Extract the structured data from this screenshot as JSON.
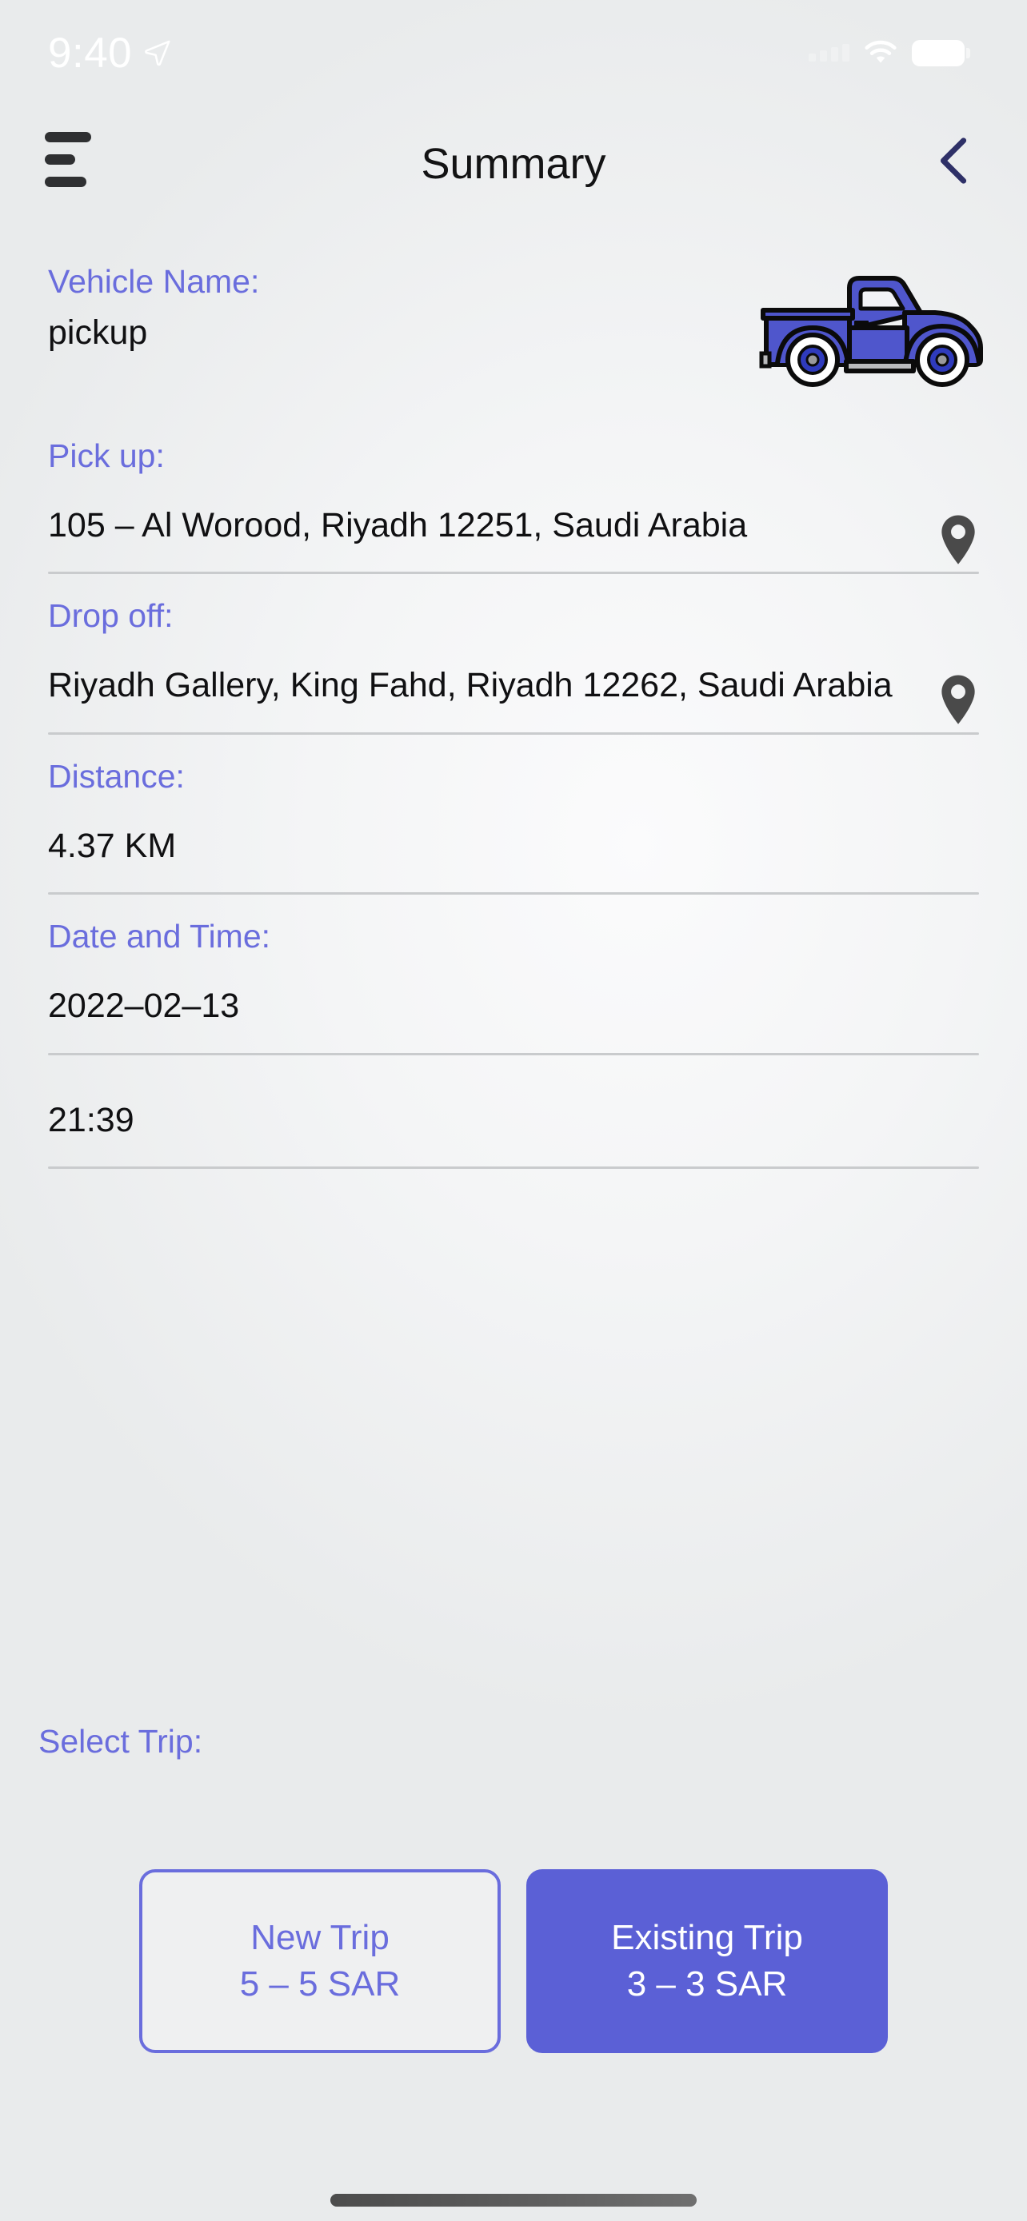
{
  "status_bar": {
    "time": "9:40",
    "location_icon": "location-arrow-icon",
    "signal_icon": "cellular-signal-icon",
    "wifi_icon": "wifi-icon",
    "battery_icon": "battery-icon"
  },
  "header": {
    "menu_icon": "hamburger-menu-icon",
    "title": "Summary",
    "back_icon": "chevron-left-icon"
  },
  "vehicle": {
    "label": "Vehicle Name:",
    "value": "pickup",
    "image_icon": "pickup-truck-illustration",
    "image_color": "#4f56cc"
  },
  "pickup": {
    "label": "Pick up:",
    "value": "105 – Al Worood, Riyadh 12251, Saudi Arabia",
    "pin_icon": "map-pin-icon"
  },
  "dropoff": {
    "label": "Drop off:",
    "value": "Riyadh Gallery, King Fahd, Riyadh 12262, Saudi Arabia",
    "pin_icon": "map-pin-icon"
  },
  "distance": {
    "label": "Distance:",
    "value": "4.37 KM"
  },
  "date_time": {
    "label": "Date and Time:",
    "date_value": "2022–02–13",
    "time_value": "21:39"
  },
  "select_trip": {
    "label": "Select Trip:",
    "options": [
      {
        "title": "New Trip",
        "price": "5 – 5 SAR",
        "selected": false
      },
      {
        "title": "Existing Trip",
        "price": "3 – 3 SAR",
        "selected": true
      }
    ]
  },
  "colors": {
    "accent": "#6a6ddd",
    "accent_filled": "#5b60d6",
    "text": "#101012",
    "divider": "#c9cbcd",
    "pin": "#4a4a4a"
  },
  "home_indicator": "home-indicator"
}
